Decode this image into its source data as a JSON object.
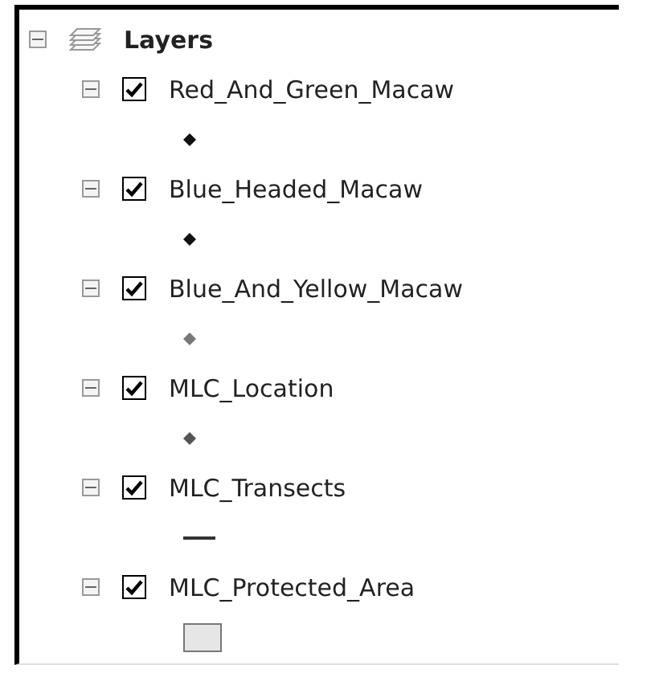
{
  "root": {
    "label": "Layers",
    "expanded": true,
    "layers": [
      {
        "label": "Red_And_Green_Macaw",
        "expanded": true,
        "checked": true,
        "symbol": {
          "kind": "point",
          "color": "#111111"
        }
      },
      {
        "label": "Blue_Headed_Macaw",
        "expanded": true,
        "checked": true,
        "symbol": {
          "kind": "point",
          "color": "#111111"
        }
      },
      {
        "label": "Blue_And_Yellow_Macaw",
        "expanded": true,
        "checked": true,
        "symbol": {
          "kind": "point",
          "color": "#777777"
        }
      },
      {
        "label": "MLC_Location",
        "expanded": true,
        "checked": true,
        "symbol": {
          "kind": "point",
          "color": "#555555"
        }
      },
      {
        "label": "MLC_Transects",
        "expanded": true,
        "checked": true,
        "symbol": {
          "kind": "line",
          "color": "#333333"
        }
      },
      {
        "label": "MLC_Protected_Area",
        "expanded": true,
        "checked": true,
        "symbol": {
          "kind": "polygon",
          "color": "#e6e6e6"
        }
      }
    ]
  }
}
